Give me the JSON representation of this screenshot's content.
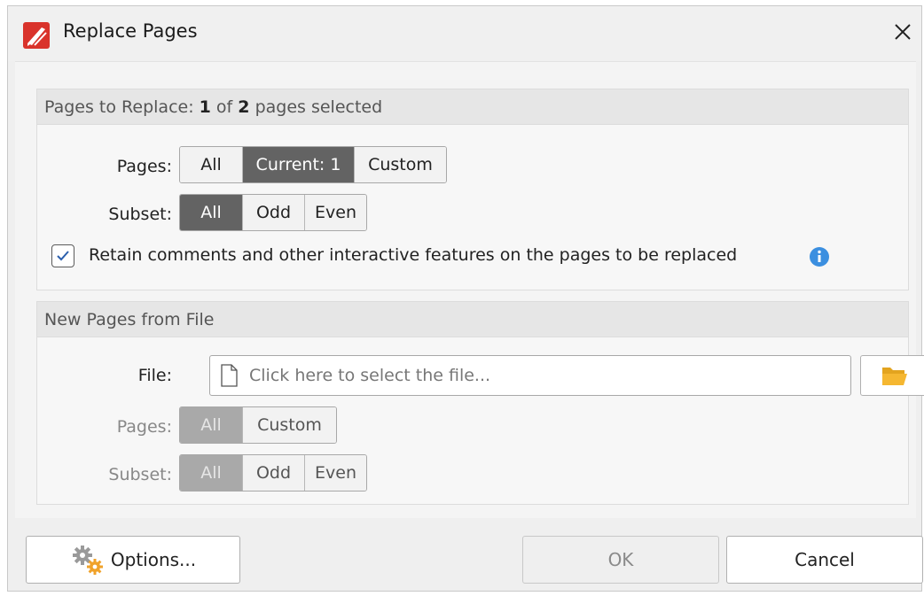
{
  "window": {
    "title": "Replace Pages",
    "icon": "pdf-editor-app-icon",
    "close_icon": "close-icon"
  },
  "pages_to_replace": {
    "header_prefix": "Pages to Replace: ",
    "selected_count": "1",
    "of_text": " of ",
    "total_count": "2",
    "header_suffix": " pages selected",
    "pages_label": "Pages:",
    "pages_options": [
      "All",
      "Current: 1",
      "Custom"
    ],
    "pages_selected": "Current: 1",
    "subset_label": "Subset:",
    "subset_options": [
      "All",
      "Odd",
      "Even"
    ],
    "subset_selected": "All",
    "retain_checkbox_checked": true,
    "retain_label": "Retain comments and other interactive features on the pages to be replaced",
    "info_icon": "info-icon"
  },
  "new_pages": {
    "header": "New Pages from File",
    "file_label": "File:",
    "file_placeholder": "Click here to select the file...",
    "browse_icon": "folder-open-icon",
    "pages_label": "Pages:",
    "pages_options": [
      "All",
      "Custom"
    ],
    "pages_selected": "All",
    "subset_label": "Subset:",
    "subset_options": [
      "All",
      "Odd",
      "Even"
    ],
    "subset_selected": "All"
  },
  "footer": {
    "options_label": "Options...",
    "options_icon": "gears-icon",
    "ok_label": "OK",
    "cancel_label": "Cancel"
  },
  "colors": {
    "active_segment": "#636363",
    "disabled_segment": "#a9a9a9",
    "info_blue": "#3b8fe0",
    "folder_yellow": "#f5b731",
    "app_red": "#d9332b"
  }
}
